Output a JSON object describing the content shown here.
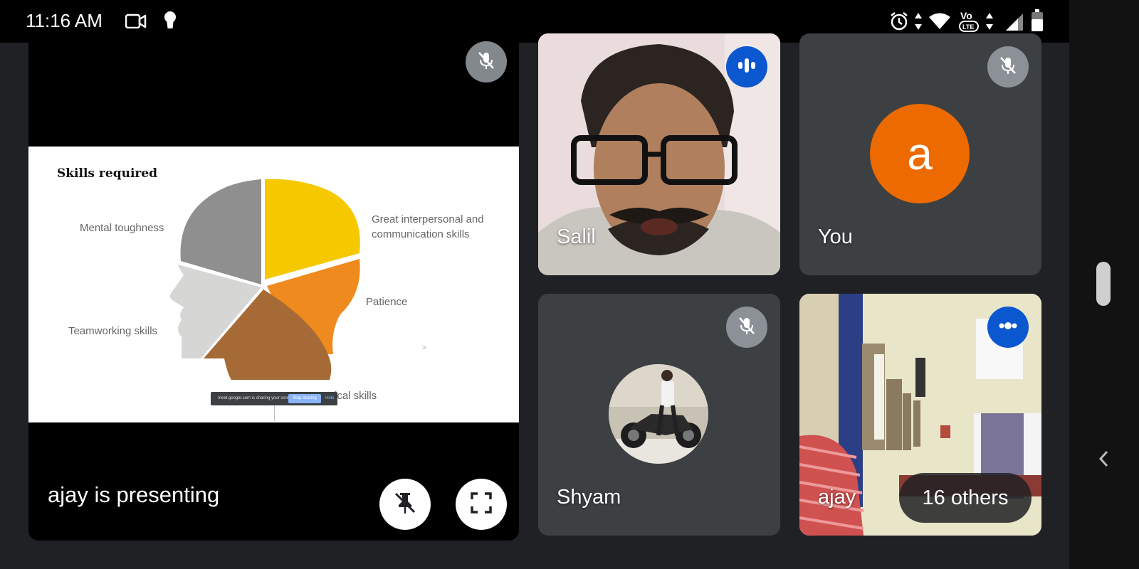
{
  "status_bar": {
    "time": "11:16 AM",
    "network_label": "Vo LTE"
  },
  "presenter_tile": {
    "label": "ajay is presenting",
    "slide": {
      "title": "Skills required",
      "labels": {
        "mental": "Mental toughness",
        "interpersonal_1": "Great interpersonal and",
        "interpersonal_2": "communication skills",
        "patience": "Patience",
        "teamwork": "Teamworking skills",
        "numerical": "Numerical skills"
      },
      "piece_colors": {
        "gray": "#8f8f8f",
        "yellow": "#f6c800",
        "orange": "#ef8a1e",
        "brown": "#a56a35",
        "light": "#d6d6d4"
      },
      "share_bar": {
        "text": "meet.google.com is sharing your screen.",
        "stop_label": "Stop sharing",
        "hide_label": "Hide"
      }
    }
  },
  "participants": {
    "salil": {
      "name": "Salil",
      "state": "speaking"
    },
    "you": {
      "name": "You",
      "avatar_letter": "a",
      "avatar_color": "#ec6a00",
      "state": "muted"
    },
    "shyam": {
      "name": "Shyam",
      "state": "muted"
    },
    "ajay": {
      "name": "ajay",
      "state": "speaking"
    }
  },
  "others_pill": {
    "label": "16 others"
  },
  "colors": {
    "background": "#202124",
    "tile": "#3c4043",
    "speaking_badge": "#0b57d0",
    "muted_badge": "#9aa0a6"
  },
  "icons": [
    "video-camera-icon",
    "keyhole-icon",
    "alarm-icon",
    "wifi-icon",
    "volte-icon",
    "cell-signal-icon",
    "battery-icon",
    "mic-off-icon",
    "speaking-icon",
    "unpin-icon",
    "fullscreen-icon",
    "chevron-left-icon"
  ]
}
